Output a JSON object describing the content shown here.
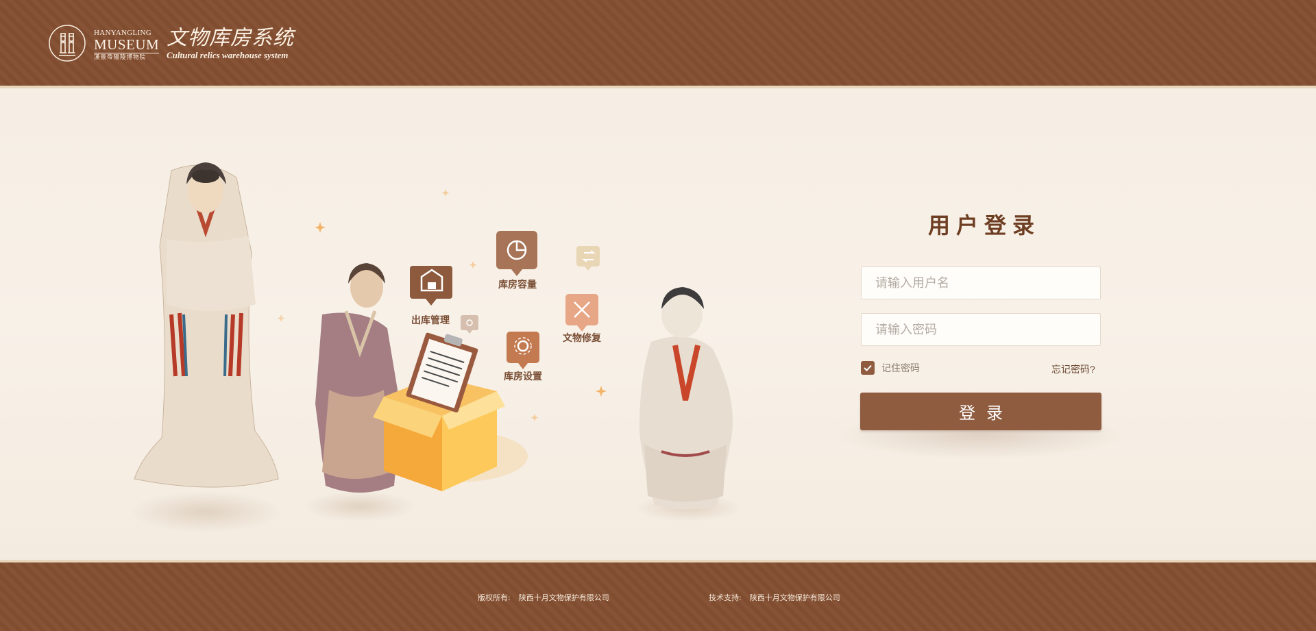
{
  "header": {
    "museum_en_small": "HANYANGLING",
    "museum_en_big": "MUSEUM",
    "museum_cn": "漢景帝陽陵博物院",
    "system_title_cn": "文物库房系统",
    "system_title_en": "Cultural relics warehouse system"
  },
  "features": {
    "outbound": "出库管理",
    "capacity": "库房容量",
    "restoration": "文物修复",
    "settings": "库房设置"
  },
  "login": {
    "title": "用户登录",
    "username_placeholder": "请输入用户名",
    "password_placeholder": "请输入密码",
    "remember_label": "记住密码",
    "remember_checked": true,
    "forgot_label": "忘记密码?",
    "submit_label": "登录"
  },
  "footer": {
    "copyright_label": "版权所有:",
    "copyright_value": "陕西十月文物保护有限公司",
    "support_label": "技术支持:",
    "support_value": "陕西十月文物保护有限公司"
  },
  "colors": {
    "brand_brown": "#844f31",
    "button": "#8f5c40",
    "background": "#f5ede3",
    "box_yellow": "#f6a93b"
  }
}
